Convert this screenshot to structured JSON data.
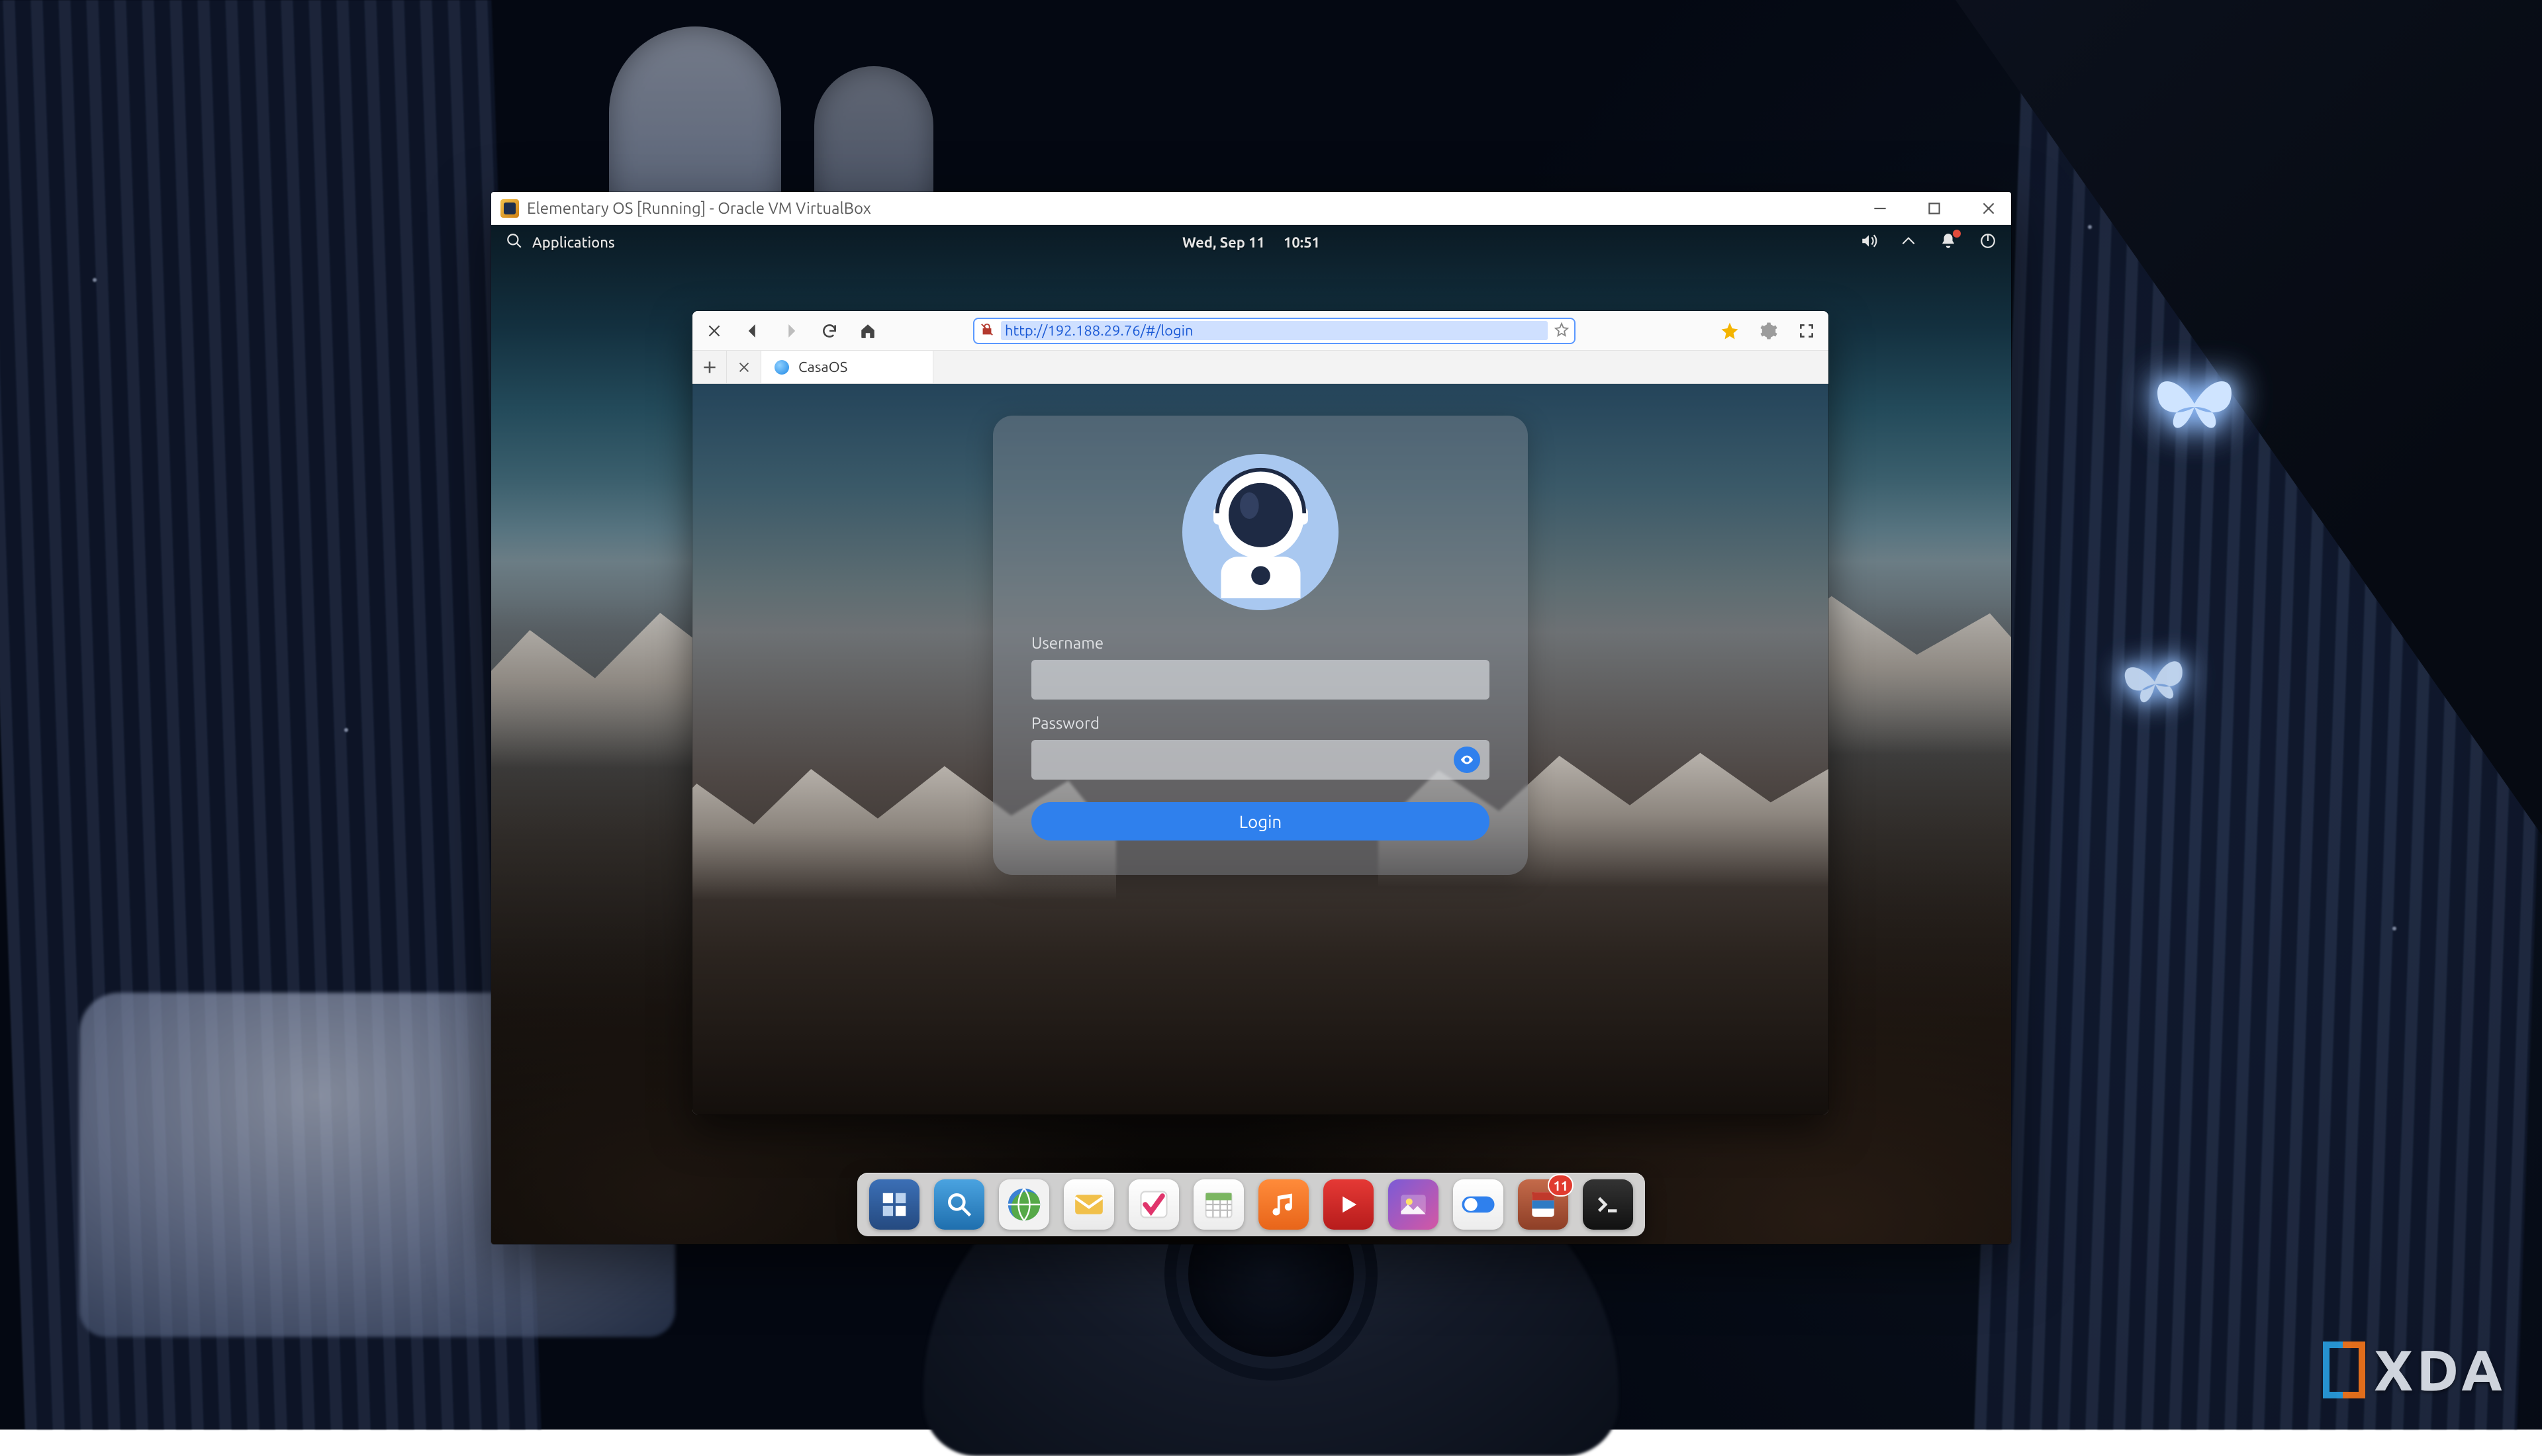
{
  "watermark": {
    "text": "XDA"
  },
  "vbox": {
    "title": "Elementary OS [Running] - Oracle VM VirtualBox"
  },
  "eos": {
    "applications_label": "Applications",
    "date": "Wed, Sep 11",
    "time": "10:51",
    "dock": {
      "badge_count": "11"
    }
  },
  "browser": {
    "url": "http://192.188.29.76/#/login",
    "tab_title": "CasaOS"
  },
  "login": {
    "username_label": "Username",
    "password_label": "Password",
    "button_label": "Login"
  }
}
